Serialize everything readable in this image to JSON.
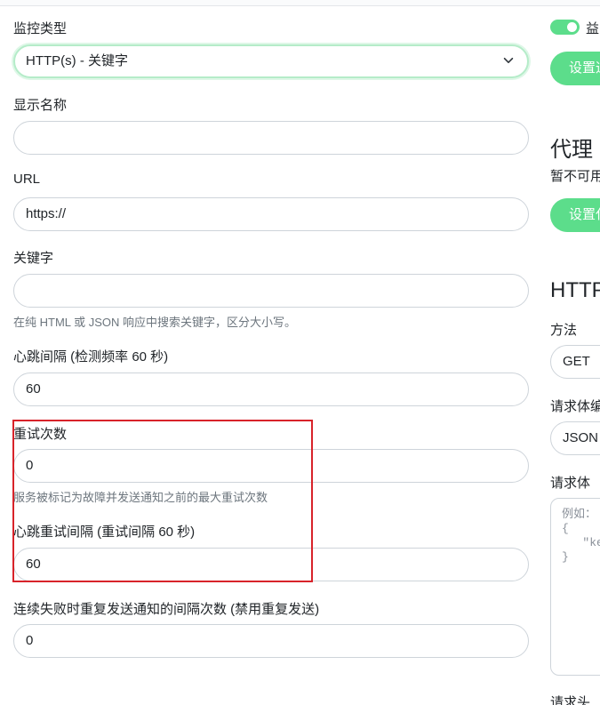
{
  "form": {
    "monitor_type_label": "监控类型",
    "monitor_type_value": "HTTP(s) - 关键字",
    "display_name_label": "显示名称",
    "display_name_value": "",
    "url_label": "URL",
    "url_value": "https://",
    "keyword_label": "关键字",
    "keyword_value": "",
    "keyword_hint": "在纯 HTML 或 JSON 响应中搜索关键字，区分大小写。",
    "heartbeat_label": "心跳间隔 (检测频率 60 秒)",
    "heartbeat_value": "60",
    "retries_label": "重试次数",
    "retries_value": "0",
    "retries_hint": "服务被标记为故障并发送通知之前的最大重试次数",
    "retry_interval_label": "心跳重试间隔 (重试间隔 60 秒)",
    "retry_interval_value": "60",
    "resend_label": "连续失败时重复发送通知的间隔次数 (禁用重复发送)",
    "resend_value": "0"
  },
  "right": {
    "toggle_label": "益",
    "setup_button_1": "设置通知",
    "proxy_heading": "代理",
    "proxy_text": "暂不可用",
    "setup_button_2": "设置代理",
    "http_heading": "HTTP",
    "method_label": "方法",
    "method_value": "GET",
    "body_encoding_label": "请求体编码",
    "body_encoding_value": "JSON",
    "body_label": "请求体",
    "body_placeholder": "例如：\n{\n   \"key\": \"value\"\n}",
    "headers_label": "请求头"
  },
  "colors": {
    "accent_green": "#5cdd8b",
    "focus_ring": "#b5ecc9",
    "highlight_red": "#d8232a"
  },
  "icons": {
    "select_chevron": "chevron-down-icon"
  }
}
